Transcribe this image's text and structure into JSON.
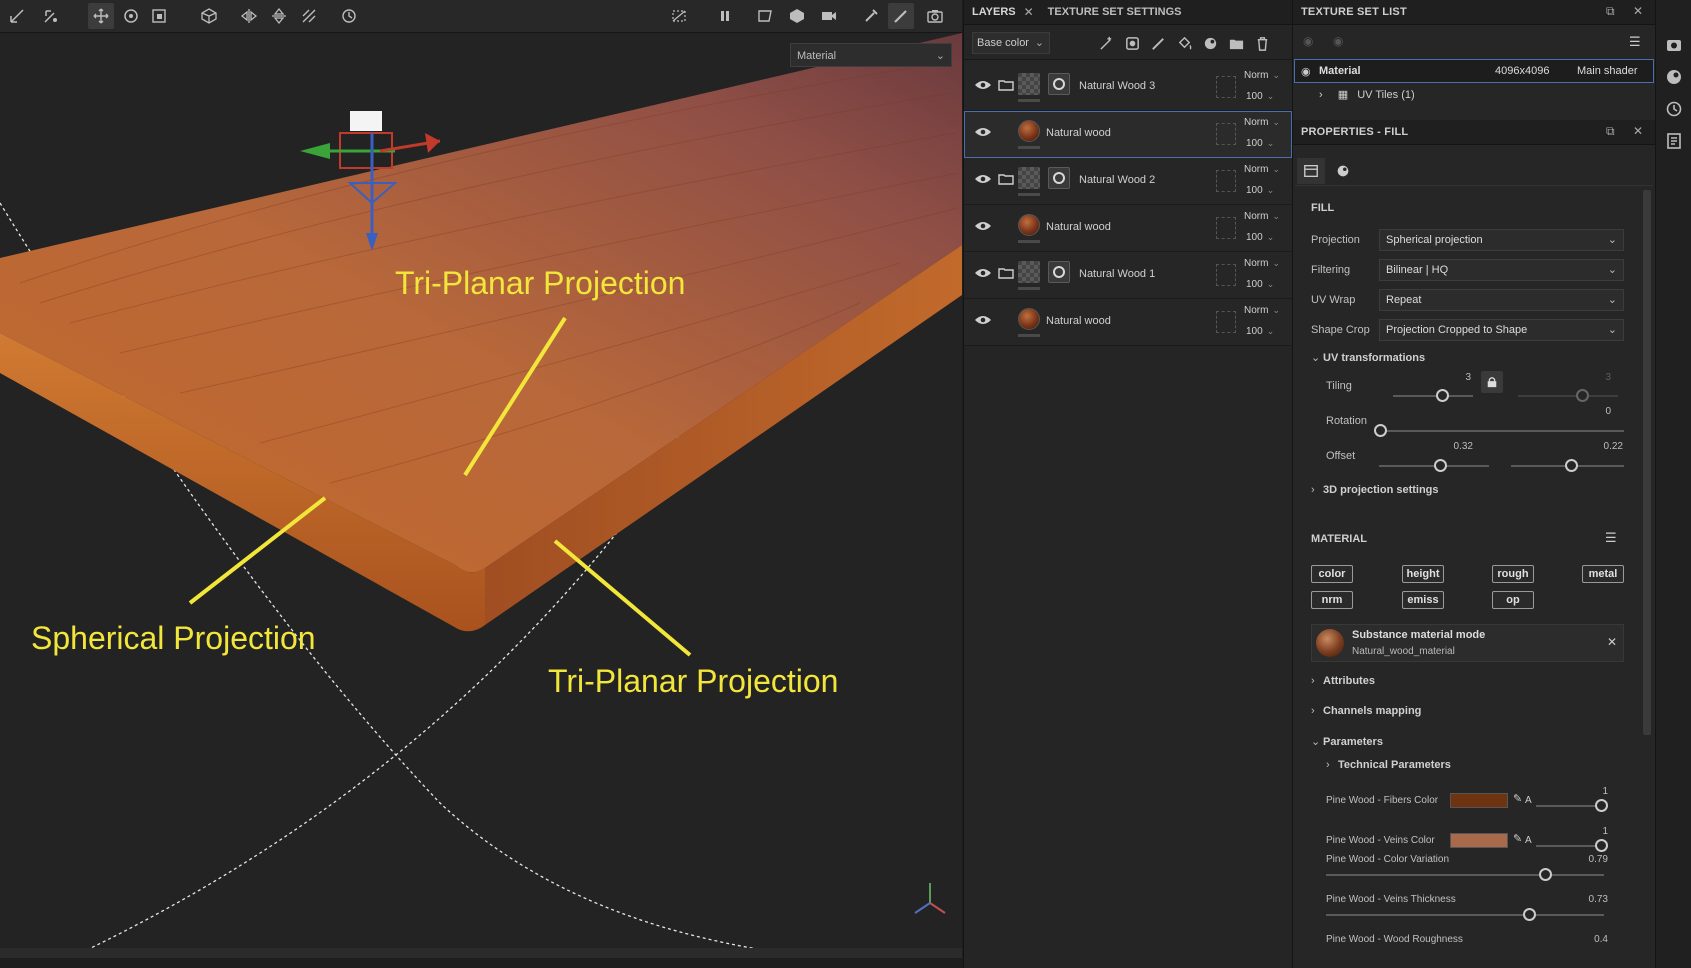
{
  "viewport": {
    "channel_select": "Material",
    "annotations": {
      "top": "Tri-Planar Projection",
      "left": "Spherical Projection",
      "right": "Tri-Planar Projection"
    }
  },
  "layers_panel": {
    "tab_layers": "LAYERS",
    "tab_texture_set_settings": "TEXTURE SET SETTINGS",
    "channel": "Base color",
    "layers": [
      {
        "name": "Natural Wood 3",
        "kind": "folder",
        "blend": "Norm",
        "opacity": "100"
      },
      {
        "name": "Natural wood",
        "kind": "fill",
        "blend": "Norm",
        "opacity": "100",
        "selected": true
      },
      {
        "name": "Natural Wood 2",
        "kind": "folder",
        "blend": "Norm",
        "opacity": "100"
      },
      {
        "name": "Natural wood",
        "kind": "fill",
        "blend": "Norm",
        "opacity": "100"
      },
      {
        "name": "Natural Wood 1",
        "kind": "folder",
        "blend": "Norm",
        "opacity": "100"
      },
      {
        "name": "Natural wood",
        "kind": "fill",
        "blend": "Norm",
        "opacity": "100"
      }
    ]
  },
  "texture_set_list": {
    "title": "TEXTURE SET LIST",
    "material_name": "Material",
    "resolution": "4096x4096",
    "shader": "Main shader",
    "uv_tiles": "UV Tiles (1)"
  },
  "properties": {
    "title": "PROPERTIES - FILL",
    "fill_title": "FILL",
    "labels": {
      "projection": "Projection",
      "filtering": "Filtering",
      "uv_wrap": "UV Wrap",
      "shape_crop": "Shape Crop"
    },
    "values": {
      "projection": "Spherical projection",
      "filtering": "Bilinear | HQ",
      "uv_wrap": "Repeat",
      "shape_crop": "Projection Cropped to Shape"
    },
    "uv_transformations": "UV transformations",
    "tiling_label": "Tiling",
    "tiling_u": "3",
    "tiling_v": "3",
    "rotation_label": "Rotation",
    "rotation": "0",
    "offset_label": "Offset",
    "offset_u": "0.32",
    "offset_v": "0.22",
    "projection_3d": "3D projection settings"
  },
  "material": {
    "title": "MATERIAL",
    "channels": [
      "color",
      "height",
      "rough",
      "metal",
      "nrm",
      "emiss",
      "op"
    ],
    "substance_title": "Substance material mode",
    "substance_name": "Natural_wood_material",
    "attributes": "Attributes",
    "channels_mapping": "Channels mapping",
    "parameters": "Parameters",
    "technical_parameters": "Technical Parameters",
    "params": [
      {
        "label": "Pine Wood - Fibers Color",
        "color": "#6e3412",
        "value": "1",
        "alpha_label": "A"
      },
      {
        "label": "Pine Wood - Veins Color",
        "color": "#a86a4a",
        "value": "1",
        "alpha_label": "A"
      },
      {
        "label": "Pine Wood - Color Variation",
        "value": "0.79"
      },
      {
        "label": "Pine Wood - Veins Thickness",
        "value": "0.73"
      },
      {
        "label": "Pine Wood - Wood Roughness",
        "value": "0.4"
      }
    ]
  },
  "colors": {
    "accent": "#4a6fb0",
    "annotation": "#f2e63a"
  }
}
